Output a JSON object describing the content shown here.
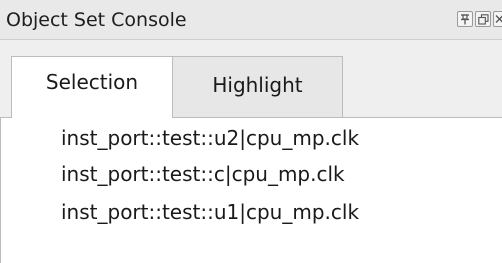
{
  "window": {
    "title": "Object Set Console",
    "buttons": {
      "pin_icon": "pin-icon",
      "float_icon": "float-icon",
      "close_icon": "close-icon"
    }
  },
  "tabs": [
    {
      "label": "Selection",
      "active": true
    },
    {
      "label": "Highlight",
      "active": false
    }
  ],
  "list": {
    "items": [
      "inst_port::test::u2|cpu_mp.clk",
      "inst_port::test::c|cpu_mp.clk",
      "inst_port::test::u1|cpu_mp.clk"
    ]
  },
  "colors": {
    "titlebar_bg": "#e9e9e9",
    "tabs_bg": "#efefef",
    "inactive_tab_bg": "#e7e7e7",
    "active_tab_bg": "#ffffff",
    "border": "#bcbcbc"
  }
}
